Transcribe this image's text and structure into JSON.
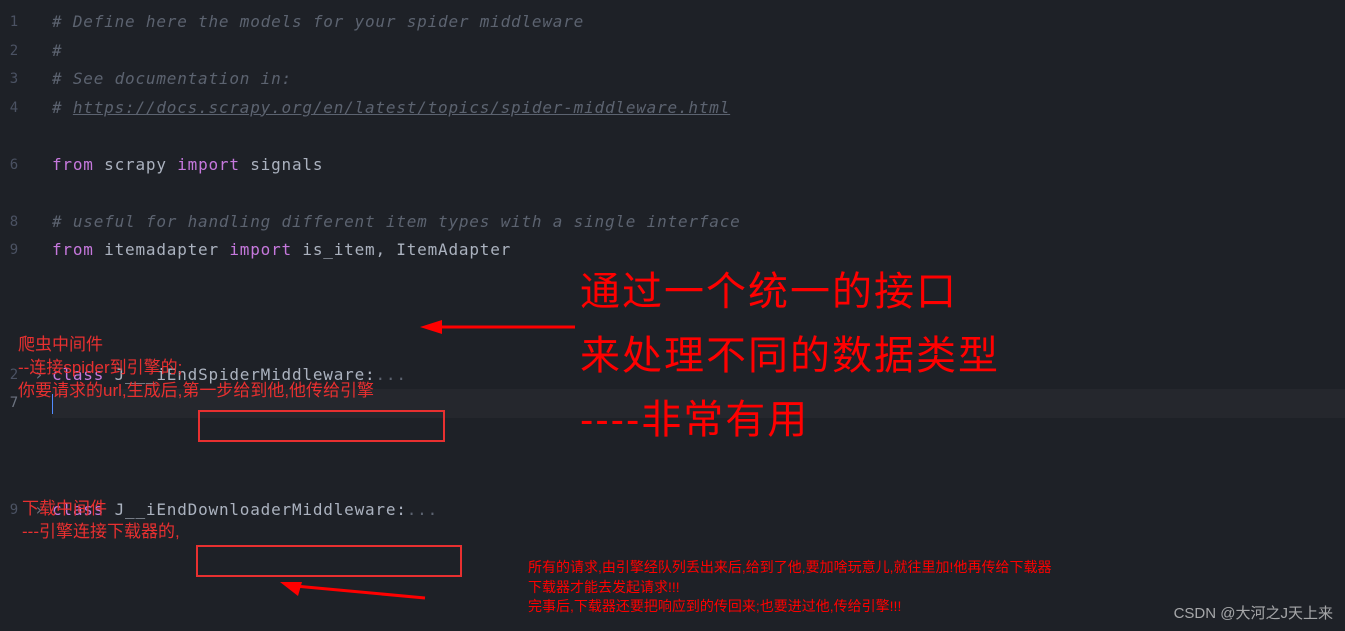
{
  "gutter": {
    "lines": [
      "1",
      "2",
      "3",
      "4",
      " ",
      "6",
      " ",
      "8",
      "9",
      " ",
      " ",
      "2",
      "7",
      " ",
      "9"
    ],
    "activeIndex": 12
  },
  "code": {
    "line1_comment": "# Define here the models for your spider middleware",
    "line2_comment": "#",
    "line3_comment": "# See documentation in:",
    "line4_comment_prefix": "# ",
    "line4_url": "https://docs.scrapy.org/en/latest/topics/spider-middleware.html",
    "line6_from": "from",
    "line6_module": " scrapy ",
    "line6_import": "import",
    "line6_names": " signals",
    "line8_comment": "# useful for handling different item types with a single interface",
    "line9_from": "from",
    "line9_module": " itemadapter ",
    "line9_import": "import",
    "line9_names": " is_item, ItemAdapter",
    "line12_class": "class",
    "line12_name_obscured": " J___iEnd",
    "line12_name_visible": "SpiderMiddleware",
    "line12_colon": ":",
    "line12_ellipsis": "...",
    "line19_class": "class",
    "line19_name_obscured": " J__iEnd",
    "line19_name_visible": "DownloaderMiddleware",
    "line19_colon": ":",
    "line19_ellipsis": "...",
    "fold_chevron": "›"
  },
  "annotations": {
    "spider_block": {
      "title": "爬虫中间件",
      "line2": "--连接spider到引擎的;",
      "line3": "你要请求的url,生成后,第一步给到他,他传给引擎"
    },
    "downloader_block": {
      "title": "下载中间件",
      "line2": "---引擎连接下载器的,"
    },
    "downloader_detail": {
      "line1": "所有的请求,由引擎经队列丢出来后,给到了他,要加啥玩意儿,就往里加!他再传给下载器",
      "line2": "下载器才能去发起请求!!!",
      "line3": "完事后,下载器还要把响应到的传回来;也要进过他,传给引擎!!!"
    },
    "large": {
      "line1": "通过一个统一的接口",
      "line2": "来处理不同的数据类型",
      "line3": "----非常有用"
    }
  },
  "watermark": "CSDN @大河之J天上来"
}
